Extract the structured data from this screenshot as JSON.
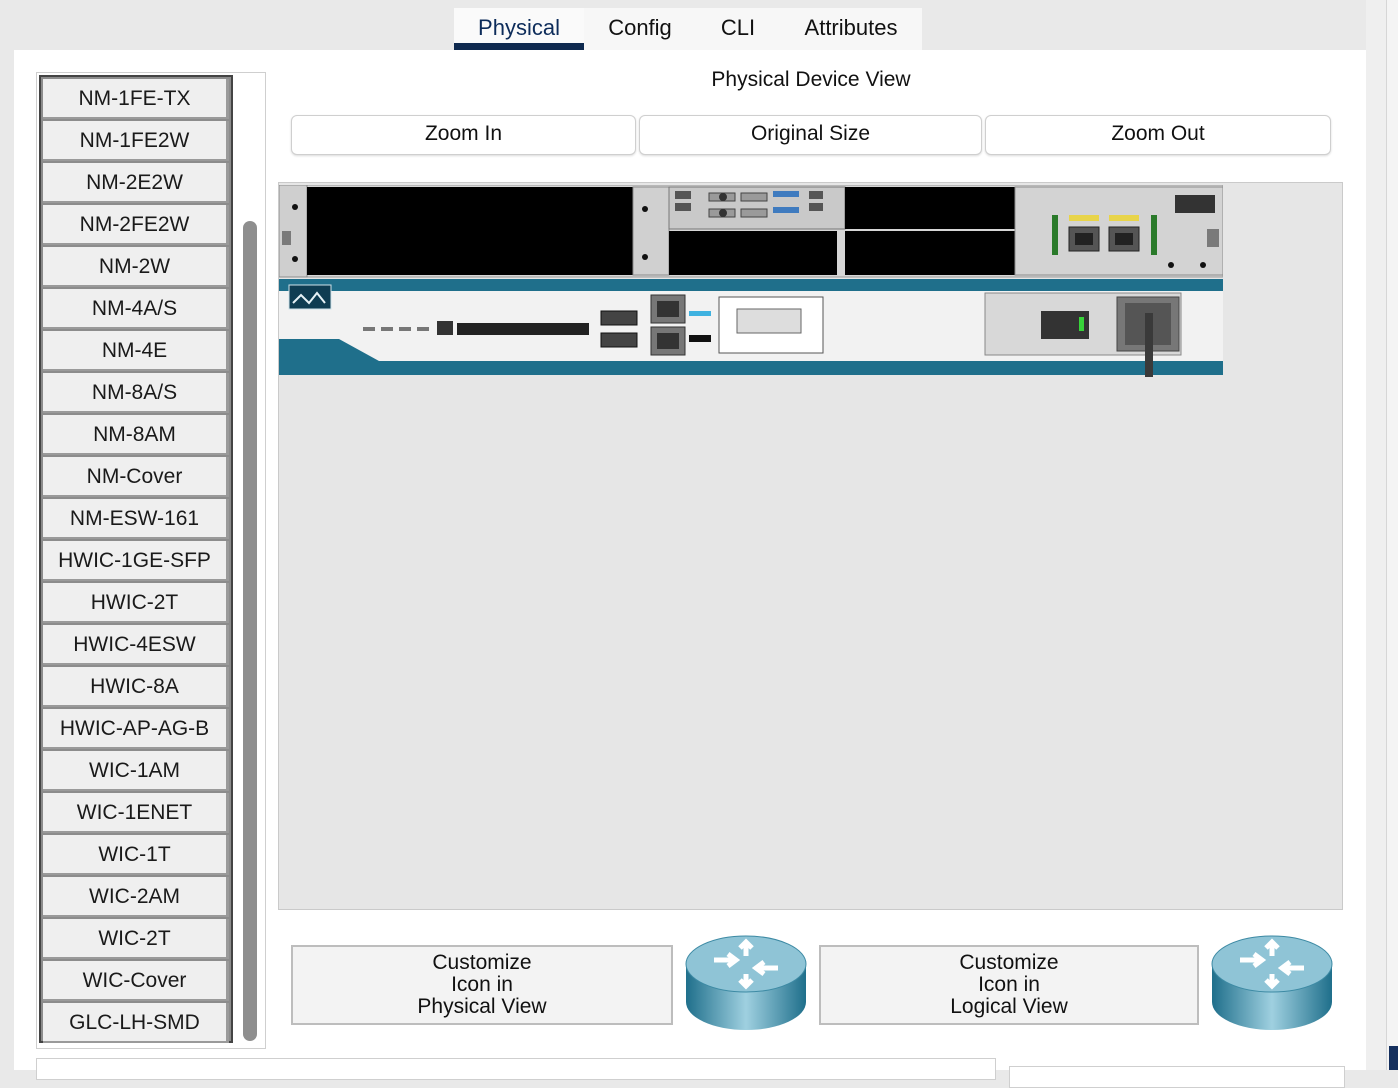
{
  "tabs": [
    {
      "label": "Physical",
      "active": true
    },
    {
      "label": "Config",
      "active": false
    },
    {
      "label": "CLI",
      "active": false
    },
    {
      "label": "Attributes",
      "active": false
    }
  ],
  "modules": [
    "NM-1FE-TX",
    "NM-1FE2W",
    "NM-2E2W",
    "NM-2FE2W",
    "NM-2W",
    "NM-4A/S",
    "NM-4E",
    "NM-8A/S",
    "NM-8AM",
    "NM-Cover",
    "NM-ESW-161",
    "HWIC-1GE-SFP",
    "HWIC-2T",
    "HWIC-4ESW",
    "HWIC-8A",
    "HWIC-AP-AG-B",
    "WIC-1AM",
    "WIC-1ENET",
    "WIC-1T",
    "WIC-2AM",
    "WIC-2T",
    "WIC-Cover",
    "GLC-LH-SMD"
  ],
  "view": {
    "title": "Physical Device View",
    "zoom_in": "Zoom In",
    "original_size": "Original Size",
    "zoom_out": "Zoom Out"
  },
  "customize": {
    "physical": [
      "Customize",
      "Icon in",
      "Physical View"
    ],
    "logical": [
      "Customize",
      "Icon in",
      "Logical View"
    ]
  },
  "colors": {
    "tab_accent": "#0f2a4f",
    "router_teal": "#1f6f8b",
    "chassis_gray": "#d4d4d4"
  }
}
